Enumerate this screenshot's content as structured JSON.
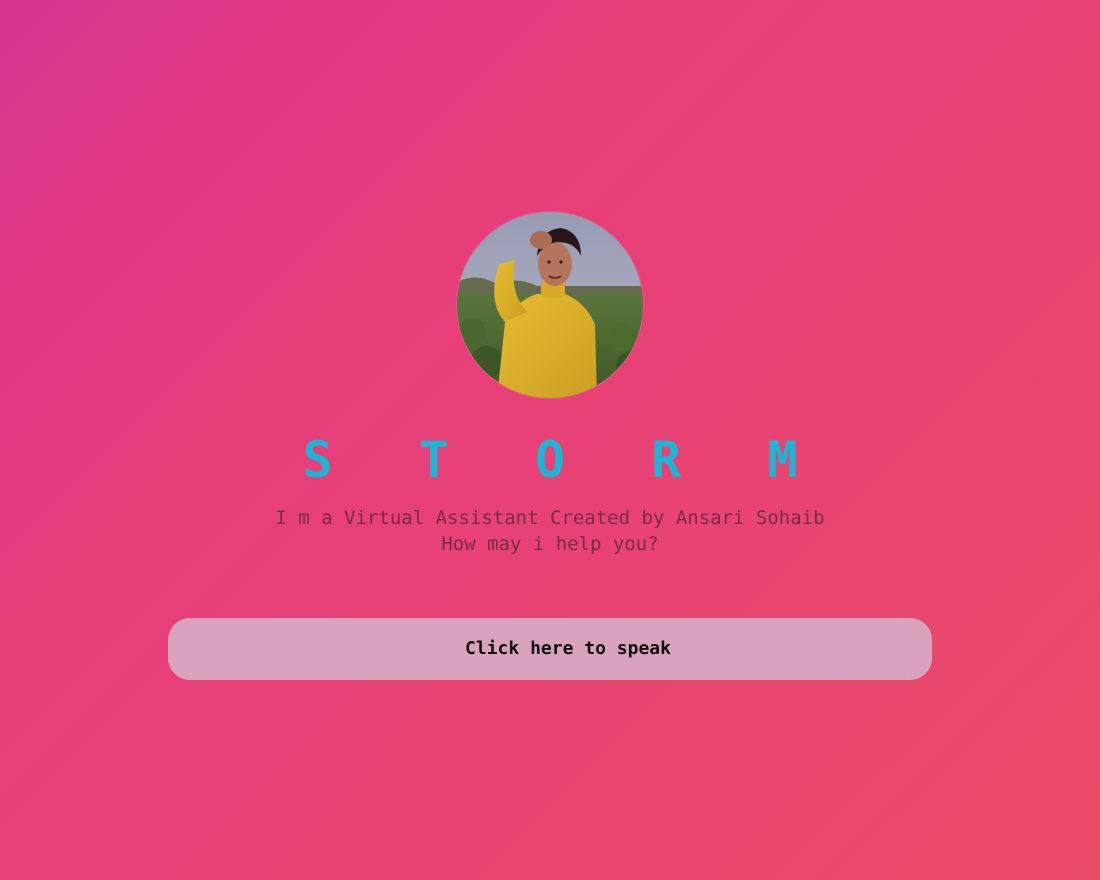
{
  "assistant": {
    "name": "S T O R M",
    "intro_line": "I m a Virtual Assistant Created by Ansari Sohaib",
    "prompt_line": "How may i help you?"
  },
  "speak_button": {
    "label": "Click here to speak"
  },
  "avatar": {
    "icon": "profile-photo",
    "alt": "Ansari Sohaib"
  },
  "colors": {
    "background_start": "#d6368f",
    "background_end": "#e84d68",
    "title": "#1fb3d4",
    "subtitle": "#7a2a4b",
    "button_bg": "#d9a3bd"
  }
}
